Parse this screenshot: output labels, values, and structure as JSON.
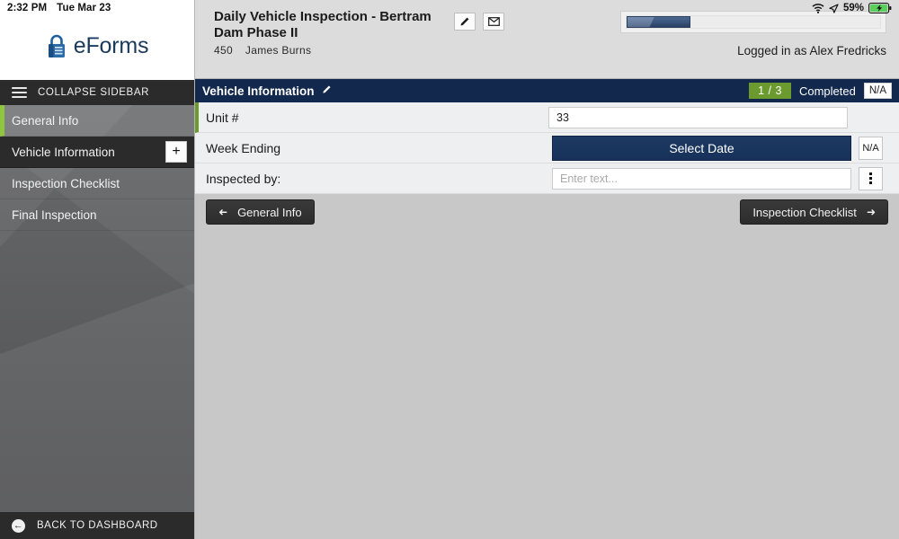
{
  "status_bar": {
    "time": "2:32 PM",
    "date": "Tue Mar 23",
    "wifi_icon": "wifi-icon",
    "location_icon": "location-arrow-icon",
    "battery_percent": "59%",
    "battery_icon": "battery-charging-icon"
  },
  "brand": {
    "logo_icon": "padlock-icon",
    "name": "eForms"
  },
  "sidebar": {
    "collapse_label": "COLLAPSE SIDEBAR",
    "menu_icon": "hamburger-icon",
    "items": [
      {
        "label": "General Info",
        "state": "visited"
      },
      {
        "label": "Vehicle Information",
        "state": "current",
        "action_label": "+"
      },
      {
        "label": "Inspection Checklist",
        "state": "default"
      },
      {
        "label": "Final Inspection",
        "state": "default"
      }
    ],
    "back_label": "BACK TO DASHBOARD",
    "back_icon": "circle-back-arrow-icon"
  },
  "header": {
    "title": "Daily Vehicle Inspection - Bertram Dam Phase II",
    "sub_number": "450",
    "sub_name": "James  Burns",
    "edit_icon": "pencil-icon",
    "mail_icon": "envelope-icon",
    "progress_percent": 25,
    "logged_in": "Logged in as Alex Fredricks"
  },
  "section": {
    "title": "Vehicle Information",
    "edit_icon": "pencil-icon",
    "count_badge": "1 / 3",
    "completed_label": "Completed",
    "na_label": "N/A"
  },
  "fields": [
    {
      "label": "Unit #",
      "type": "text",
      "value": "33",
      "placeholder": ""
    },
    {
      "label": "Week Ending",
      "type": "date-button",
      "button_label": "Select Date",
      "side_button": "N/A"
    },
    {
      "label": "Inspected by:",
      "type": "text",
      "value": "",
      "placeholder": "Enter text...",
      "side_button_icon": "kebab-menu-icon"
    }
  ],
  "footer_nav": {
    "prev_label": "General Info",
    "prev_icon": "arrow-left-icon",
    "next_label": "Inspection Checklist",
    "next_icon": "arrow-right-icon"
  },
  "colors": {
    "section_bar": "#12284c",
    "accent_green": "#6b9b2f",
    "primary_button": "#1d3a63",
    "sidebar_dark": "#2b2b2b"
  }
}
